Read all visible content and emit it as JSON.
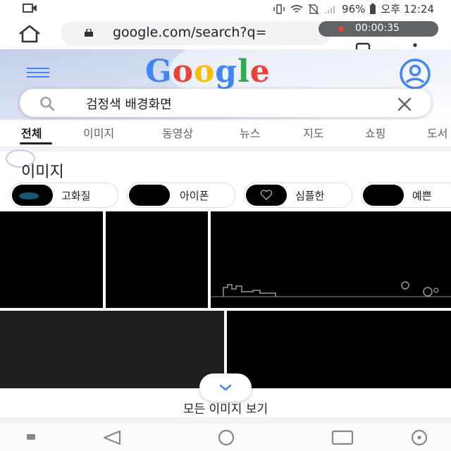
{
  "status_bar": {
    "battery": "96%",
    "time": "오후 12:24"
  },
  "browser": {
    "url": "google.com/search?q=",
    "recording_timer": "00:00:35"
  },
  "google": {
    "logo_letters": [
      "G",
      "o",
      "o",
      "g",
      "l",
      "e"
    ]
  },
  "search": {
    "query": "검정색 배경화면"
  },
  "tabs": [
    {
      "label": "전체",
      "active": true
    },
    {
      "label": "이미지"
    },
    {
      "label": "동영상"
    },
    {
      "label": "뉴스"
    },
    {
      "label": "지도"
    },
    {
      "label": "쇼핑"
    },
    {
      "label": "도서"
    }
  ],
  "images_section": {
    "title": "이미지",
    "chips": [
      "고화질",
      "아이폰",
      "심플한",
      "예쁜"
    ],
    "expand_label": "모든 이미지 보기"
  },
  "colors": {
    "accent": "#4285f4",
    "image_bg": "#000000"
  }
}
